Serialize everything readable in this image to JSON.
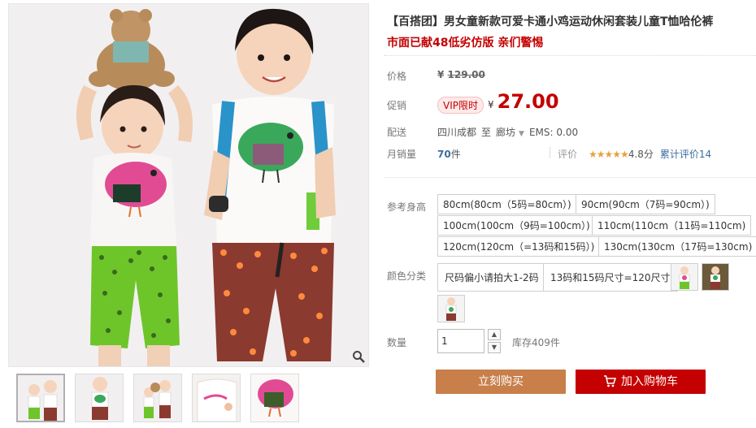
{
  "product": {
    "title": "【百搭团】男女童新款可爱卡通小鸡运动休闲套装儿童T恤哈伦裤",
    "subtitle": "市面已献48低劣仿版 亲们警惕"
  },
  "price": {
    "label": "价格",
    "currency": "¥",
    "original": "129.00"
  },
  "promo": {
    "label": "促销",
    "badge": "VIP限时",
    "currency": "¥",
    "price": "27.00"
  },
  "shipping": {
    "label": "配送",
    "from": "四川成都",
    "to_word": "至",
    "destination": "廊坊",
    "ems": "EMS: 0.00"
  },
  "sales": {
    "label": "月销量",
    "count": "70",
    "unit": "件"
  },
  "rating": {
    "label": "评价",
    "stars": "★★★★★",
    "score": "4.8分",
    "total": "累计评价14"
  },
  "size": {
    "label": "参考身高",
    "options": [
      "80cm(80cm（5码=80cm）)",
      "90cm(90cm（7码=90cm）)",
      "100cm(100cm（9码=100cm）)",
      "110cm(110cm（11码=110cm)",
      "120cm(120cm（=13码和15码）)",
      "130cm(130cm（17码=130cm)"
    ]
  },
  "color": {
    "label": "颜色分类",
    "options": [
      "尺码偏小请拍大1-2码",
      "13码和15码尺寸=120尺寸"
    ],
    "swatches": [
      "girl-photo-swatch",
      "boy-photo-swatch",
      "boy-standing-swatch"
    ]
  },
  "quantity": {
    "label": "数量",
    "value": "1",
    "stock": "库存409件"
  },
  "actions": {
    "buy_now": "立刻购买",
    "add_to_cart": "加入购物车"
  },
  "colors": {
    "accent_red": "#c40000",
    "buy_brown": "#c87f4a",
    "link_blue": "#3c6e9e",
    "star_gold": "#e6a23c"
  },
  "thumbnails": [
    "kids-together",
    "boy-front",
    "kids-teddy",
    "shirt-detail",
    "chick-print-detail"
  ]
}
